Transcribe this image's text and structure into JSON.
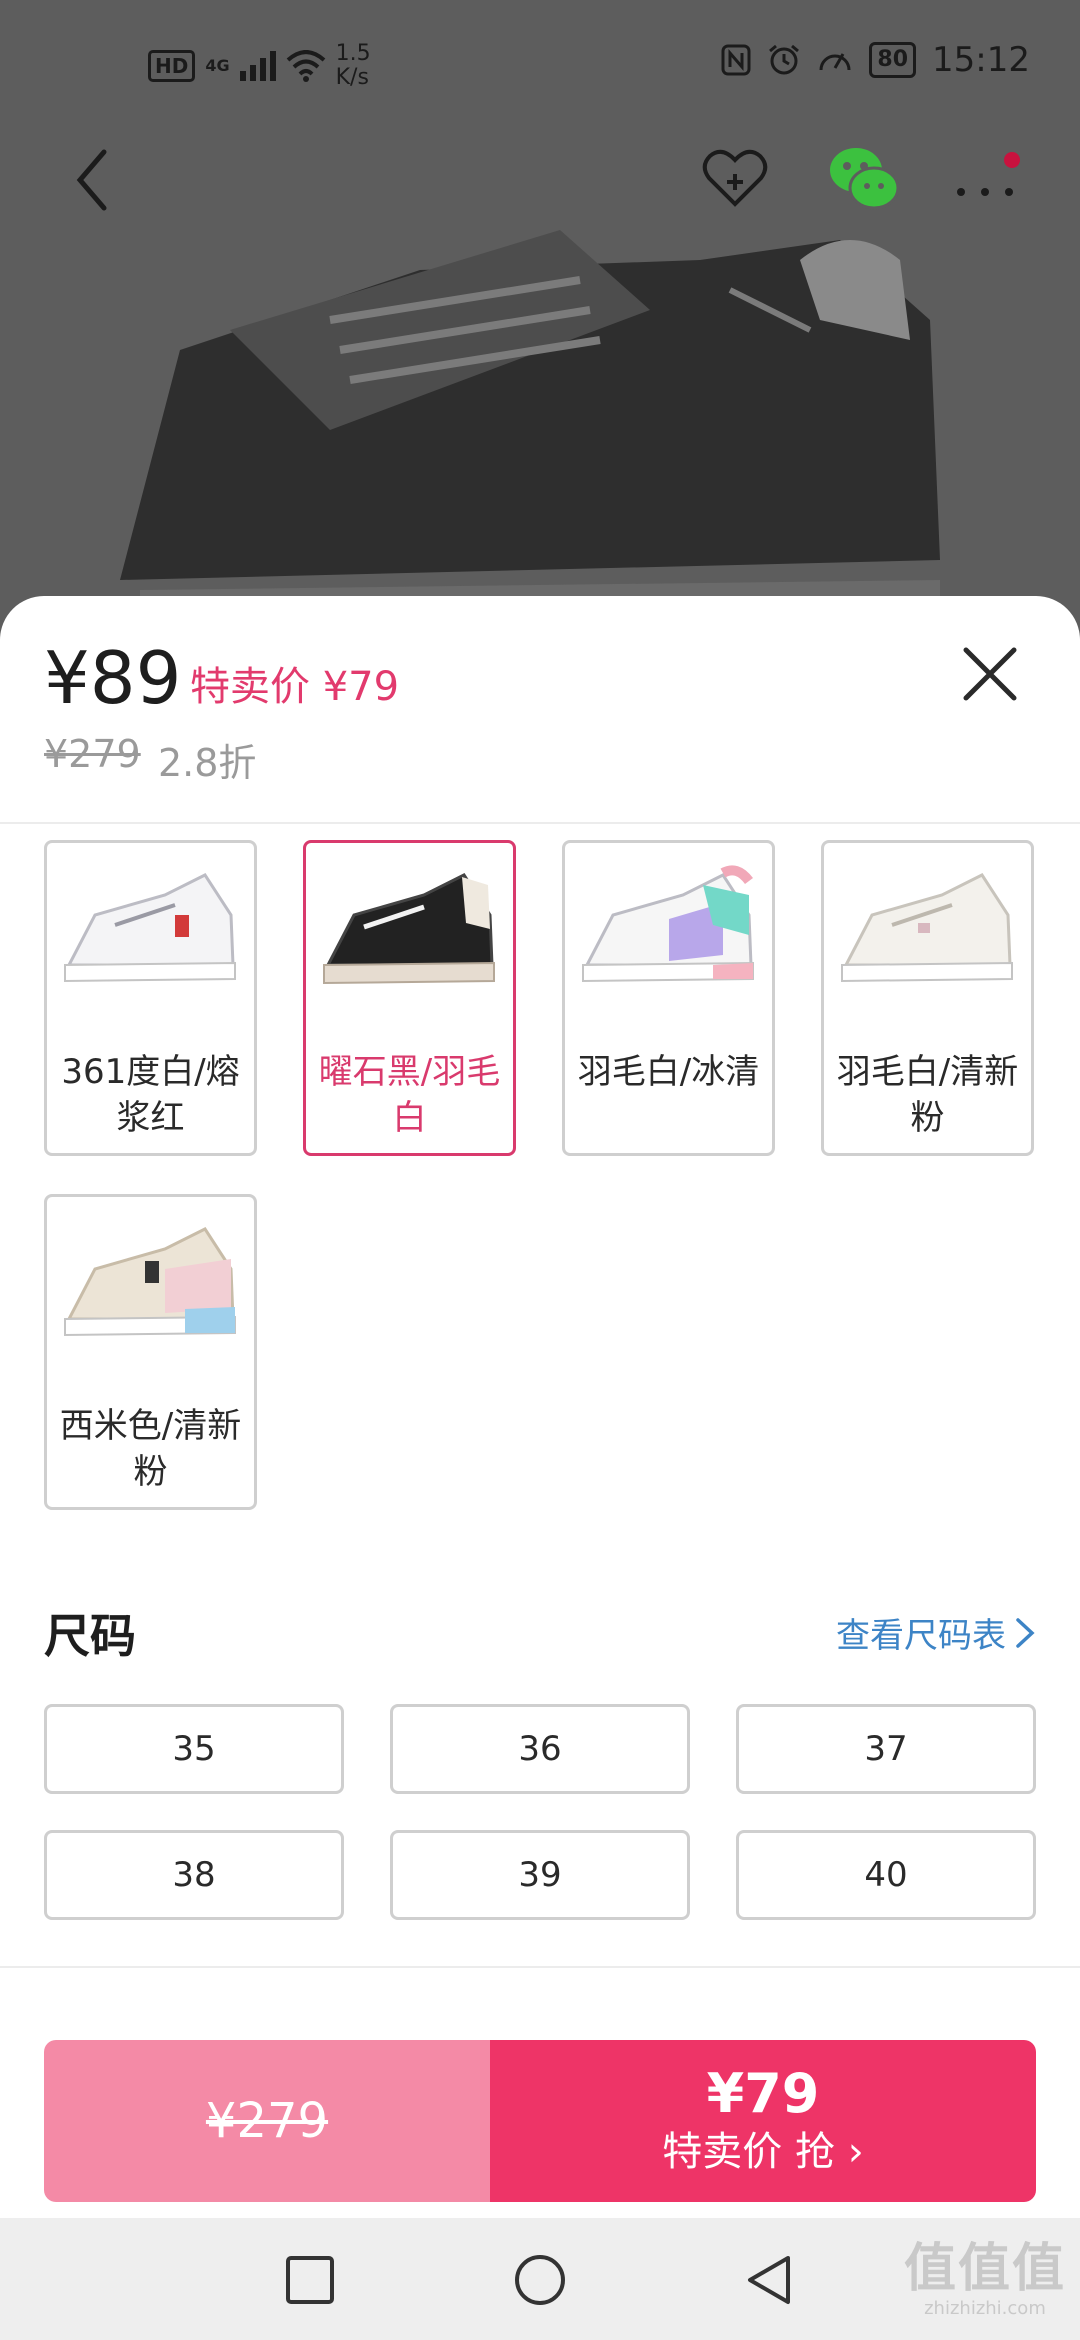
{
  "status_bar": {
    "hd": "HD",
    "network": "4G",
    "speed_value": "1.5",
    "speed_unit": "K/s",
    "battery": "80",
    "time": "15:12"
  },
  "sheet": {
    "price": "¥89",
    "promo_label": "特卖价 ¥79",
    "original_price": "¥279",
    "discount": "2.8折",
    "colors": [
      {
        "label": "361度白/熔浆红",
        "selected": false
      },
      {
        "label": "曜石黑/羽毛白",
        "selected": true
      },
      {
        "label": "羽毛白/冰清",
        "selected": false
      },
      {
        "label": "羽毛白/清新粉",
        "selected": false
      },
      {
        "label": "西米色/清新粉",
        "selected": false
      }
    ],
    "size_title": "尺码",
    "size_chart_link": "查看尺码表",
    "sizes": [
      "35",
      "36",
      "37",
      "38",
      "39",
      "40"
    ]
  },
  "buy_bar": {
    "original_price": "¥279",
    "sale_price": "¥79",
    "sale_label": "特卖价 抢 ›"
  },
  "watermark": {
    "main": "值值值",
    "sub": "zhizhizhi.com"
  },
  "colors": {
    "accent_pink": "#e23a6d",
    "buy_button": "#ee3467",
    "buy_button_light": "#f48aa6",
    "link_blue": "#3d84c6",
    "wechat_green": "#3cc13f"
  }
}
